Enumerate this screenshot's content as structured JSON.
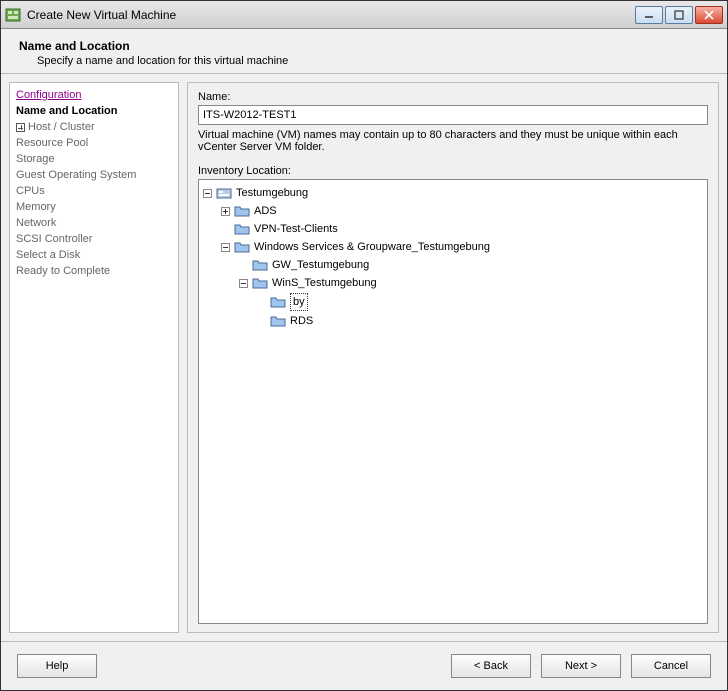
{
  "window": {
    "title": "Create New Virtual Machine"
  },
  "header": {
    "title": "Name and Location",
    "subtitle": "Specify a name and location for this virtual machine"
  },
  "sidebar": {
    "steps": [
      {
        "label": "Configuration",
        "state": "link"
      },
      {
        "label": "Name and Location",
        "state": "current"
      },
      {
        "label": "Host / Cluster",
        "state": "hasbox"
      },
      {
        "label": "Resource Pool",
        "state": ""
      },
      {
        "label": "Storage",
        "state": ""
      },
      {
        "label": "Guest Operating System",
        "state": ""
      },
      {
        "label": "CPUs",
        "state": ""
      },
      {
        "label": "Memory",
        "state": ""
      },
      {
        "label": "Network",
        "state": ""
      },
      {
        "label": "SCSI Controller",
        "state": ""
      },
      {
        "label": "Select a Disk",
        "state": ""
      },
      {
        "label": "Ready to Complete",
        "state": ""
      }
    ]
  },
  "form": {
    "name_label": "Name:",
    "name_value": "ITS-W2012-TEST1",
    "help_text": "Virtual machine (VM) names may contain up to 80 characters and they must be unique within each vCenter Server VM folder.",
    "inventory_label": "Inventory Location:"
  },
  "tree": {
    "root": "Testumgebung",
    "nodes": {
      "ads": "ADS",
      "vpn": "VPN-Test-Clients",
      "winservices": "Windows Services & Groupware_Testumgebung",
      "gw": "GW_Testumgebung",
      "wins": "WinS_Testumgebung",
      "by": "by",
      "rds": "RDS"
    }
  },
  "buttons": {
    "help": "Help",
    "back": "< Back",
    "next": "Next >",
    "cancel": "Cancel"
  }
}
